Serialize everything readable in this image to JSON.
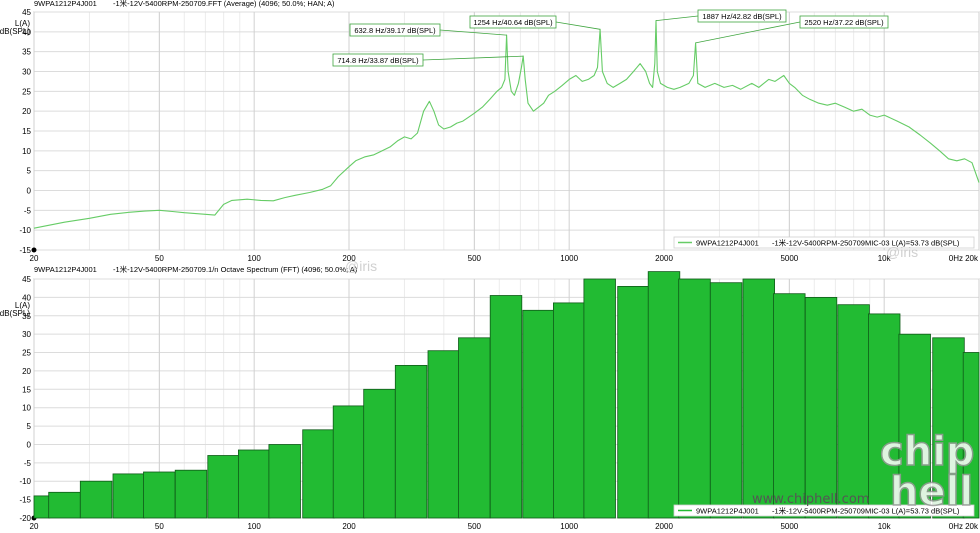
{
  "watermark": {
    "iris": "@iris",
    "logo": "chip hell",
    "site": "www.chiphell.com"
  },
  "chart_data": [
    {
      "type": "line",
      "header_left": "9WPA1212P4J001",
      "title": "-1米-12V-5400RPM-250709.FFT (Average) (4096; 50.0%; HAN; A)",
      "ylabel": [
        "L(A)",
        "dB(SPL)"
      ],
      "xlabel": "",
      "x_scale": "log",
      "xlim": [
        20,
        20000
      ],
      "ylim": [
        -15,
        45
      ],
      "x_ticks": [
        {
          "value": 20,
          "label": "20"
        },
        {
          "value": 50,
          "label": "50"
        },
        {
          "value": 100,
          "label": "100"
        },
        {
          "value": 200,
          "label": "200"
        },
        {
          "value": 500,
          "label": "500"
        },
        {
          "value": 1000,
          "label": "1000"
        },
        {
          "value": 2000,
          "label": "2000"
        },
        {
          "value": 5000,
          "label": "5000"
        },
        {
          "value": 10000,
          "label": "10k"
        },
        {
          "value": 20000,
          "label": "20k"
        }
      ],
      "x_tick_extra": "0Hz",
      "y_ticks": [
        45,
        40,
        35,
        30,
        25,
        20,
        15,
        10,
        5,
        0,
        -5,
        -10,
        -15
      ],
      "grid": true,
      "color": "#66cc66",
      "legend": {
        "position": "bottom-right",
        "series": "9WPA1212P4J001",
        "info": "-1米-12V-5400RPM-250709MIC-03 L(A)=53.73 dB(SPL)"
      },
      "annotations": [
        {
          "label": "632.8 Hz/39.17 dB(SPL)",
          "x": 632.8,
          "y": 39.17
        },
        {
          "label": "714.8 Hz/33.87 dB(SPL)",
          "x": 714.8,
          "y": 33.87
        },
        {
          "label": "1254 Hz/40.64 dB(SPL)",
          "x": 1254,
          "y": 40.64
        },
        {
          "label": "1887 Hz/42.82 dB(SPL)",
          "x": 1887,
          "y": 42.82
        },
        {
          "label": "2520 Hz/37.22 dB(SPL)",
          "x": 2520,
          "y": 37.22
        }
      ],
      "series": [
        {
          "name": "9WPA1212P4J001",
          "points": [
            [
              20,
              -9.5
            ],
            [
              25,
              -8
            ],
            [
              30,
              -7
            ],
            [
              35,
              -6
            ],
            [
              40,
              -5.5
            ],
            [
              45,
              -5.2
            ],
            [
              50,
              -5
            ],
            [
              55,
              -5.3
            ],
            [
              60,
              -5.6
            ],
            [
              70,
              -6
            ],
            [
              75,
              -6.2
            ],
            [
              80,
              -3.5
            ],
            [
              85,
              -2.5
            ],
            [
              95,
              -2.2
            ],
            [
              105,
              -2.5
            ],
            [
              115,
              -2.6
            ],
            [
              125,
              -1.8
            ],
            [
              135,
              -1.2
            ],
            [
              150,
              -0.5
            ],
            [
              165,
              0.3
            ],
            [
              175,
              1.2
            ],
            [
              185,
              3.5
            ],
            [
              200,
              6
            ],
            [
              210,
              7.5
            ],
            [
              225,
              8.5
            ],
            [
              240,
              9
            ],
            [
              255,
              10
            ],
            [
              270,
              11
            ],
            [
              285,
              12.5
            ],
            [
              300,
              13.5
            ],
            [
              315,
              13
            ],
            [
              330,
              14.5
            ],
            [
              345,
              20
            ],
            [
              360,
              22.5
            ],
            [
              372,
              20
            ],
            [
              385,
              16.5
            ],
            [
              400,
              15.5
            ],
            [
              420,
              16
            ],
            [
              440,
              17
            ],
            [
              460,
              17.5
            ],
            [
              480,
              18.5
            ],
            [
              500,
              19.5
            ],
            [
              530,
              21
            ],
            [
              560,
              23
            ],
            [
              590,
              25
            ],
            [
              610,
              26
            ],
            [
              625,
              28
            ],
            [
              632.8,
              39.17
            ],
            [
              640,
              30
            ],
            [
              655,
              25
            ],
            [
              670,
              24
            ],
            [
              690,
              27
            ],
            [
              705,
              31
            ],
            [
              714.8,
              33.87
            ],
            [
              725,
              28
            ],
            [
              740,
              22
            ],
            [
              770,
              20
            ],
            [
              800,
              21
            ],
            [
              830,
              22
            ],
            [
              860,
              24
            ],
            [
              900,
              25
            ],
            [
              950,
              26.5
            ],
            [
              1000,
              28
            ],
            [
              1050,
              29
            ],
            [
              1100,
              27.5
            ],
            [
              1150,
              28
            ],
            [
              1200,
              29
            ],
            [
              1230,
              31
            ],
            [
              1254,
              40.64
            ],
            [
              1275,
              30
            ],
            [
              1320,
              27
            ],
            [
              1380,
              26
            ],
            [
              1450,
              27
            ],
            [
              1520,
              28
            ],
            [
              1600,
              30
            ],
            [
              1680,
              32
            ],
            [
              1750,
              30
            ],
            [
              1800,
              27
            ],
            [
              1840,
              26
            ],
            [
              1870,
              32
            ],
            [
              1887,
              42.82
            ],
            [
              1905,
              30
            ],
            [
              1950,
              27
            ],
            [
              2050,
              26
            ],
            [
              2150,
              25.5
            ],
            [
              2250,
              26
            ],
            [
              2400,
              27
            ],
            [
              2480,
              29
            ],
            [
              2520,
              37.22
            ],
            [
              2560,
              27
            ],
            [
              2700,
              26
            ],
            [
              2900,
              27
            ],
            [
              3100,
              26
            ],
            [
              3300,
              26.5
            ],
            [
              3500,
              25.5
            ],
            [
              3800,
              27
            ],
            [
              4000,
              26
            ],
            [
              4300,
              28
            ],
            [
              4500,
              27.5
            ],
            [
              4800,
              29
            ],
            [
              5000,
              27
            ],
            [
              5200,
              26
            ],
            [
              5500,
              24
            ],
            [
              5800,
              23
            ],
            [
              6200,
              22
            ],
            [
              6600,
              21.5
            ],
            [
              7000,
              22
            ],
            [
              7500,
              21
            ],
            [
              8000,
              20
            ],
            [
              8500,
              20.5
            ],
            [
              9000,
              19
            ],
            [
              9500,
              18.5
            ],
            [
              10000,
              19
            ],
            [
              11000,
              17.5
            ],
            [
              12000,
              16
            ],
            [
              13000,
              14
            ],
            [
              14000,
              12
            ],
            [
              15000,
              10
            ],
            [
              16000,
              8
            ],
            [
              17000,
              7.5
            ],
            [
              18000,
              8
            ],
            [
              19000,
              7
            ],
            [
              20000,
              2
            ]
          ]
        }
      ]
    },
    {
      "type": "bar",
      "header_left": "9WPA1212P4J001",
      "title": "-1米-12V-5400RPM-250709.1/n Octave Spectrum (FFT) (4096; 50.0%; A)",
      "ylabel": [
        "L(A)",
        "dB(SPL)"
      ],
      "xlabel": "",
      "x_scale": "log",
      "xlim": [
        20,
        20000
      ],
      "ylim": [
        -20,
        45
      ],
      "x_ticks": [
        {
          "value": 20,
          "label": "20"
        },
        {
          "value": 50,
          "label": "50"
        },
        {
          "value": 100,
          "label": "100"
        },
        {
          "value": 200,
          "label": "200"
        },
        {
          "value": 500,
          "label": "500"
        },
        {
          "value": 1000,
          "label": "1000"
        },
        {
          "value": 2000,
          "label": "2000"
        },
        {
          "value": 5000,
          "label": "5000"
        },
        {
          "value": 10000,
          "label": "10k"
        },
        {
          "value": 20000,
          "label": "20k"
        }
      ],
      "x_tick_extra": "0Hz",
      "y_ticks": [
        45,
        40,
        35,
        30,
        25,
        20,
        15,
        10,
        5,
        0,
        -5,
        -10,
        -15,
        -20
      ],
      "grid": true,
      "color": "#22bb33",
      "legend": {
        "position": "bottom-right",
        "series": "9WPA1212P4J001",
        "info": "-1米-12V-5400RPM-250709MIC-03 L(A)=53.73 dB(SPL)"
      },
      "categories": [
        20,
        25,
        31.5,
        40,
        50,
        63,
        80,
        100,
        125,
        160,
        200,
        250,
        315,
        400,
        500,
        630,
        800,
        1000,
        1250,
        1600,
        2000,
        2500,
        3150,
        4000,
        5000,
        6300,
        8000,
        10000,
        12500,
        16000,
        20000
      ],
      "values": [
        -14,
        -13,
        -10,
        -8,
        -7.5,
        -7,
        -3,
        -1.5,
        0,
        4,
        10.5,
        15,
        21.5,
        25.5,
        29,
        40.5,
        36.5,
        38.5,
        45,
        43,
        47,
        45,
        44,
        45,
        41,
        40,
        38,
        35.5,
        30,
        29,
        25
      ]
    }
  ]
}
